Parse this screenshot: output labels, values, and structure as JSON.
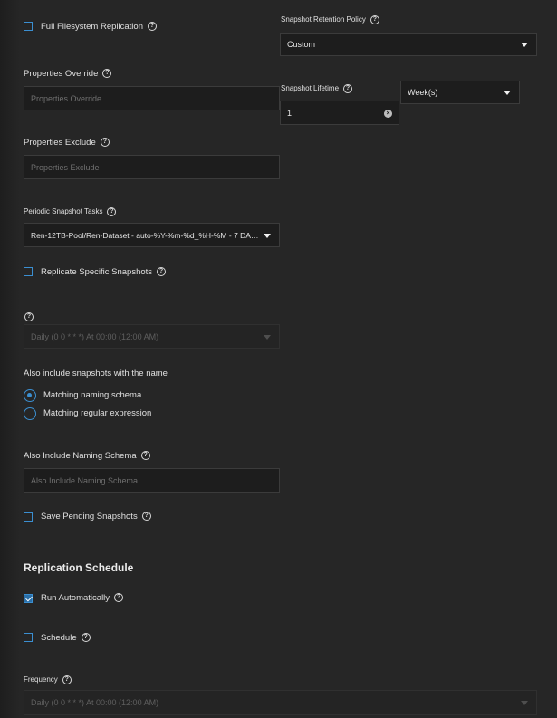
{
  "full_fs": {
    "label": "Full Filesystem Replication",
    "checked": false
  },
  "retention": {
    "label": "Snapshot Retention Policy",
    "value": "Custom"
  },
  "lifetime": {
    "label": "Snapshot Lifetime",
    "value": "1",
    "unit": "Week(s)"
  },
  "props_override": {
    "label": "Properties Override",
    "placeholder": "Properties Override"
  },
  "props_exclude": {
    "label": "Properties Exclude",
    "placeholder": "Properties Exclude"
  },
  "periodic": {
    "label": "Periodic Snapshot Tasks",
    "value": "Ren-12TB-Pool/Ren-Dataset - auto-%Y-%m-%d_%H-%M - 7 DA…"
  },
  "replicate_specific": {
    "label": "Replicate Specific Snapshots",
    "checked": false
  },
  "specific_schedule": {
    "value": "Daily (0 0 * * *)  At 00:00 (12:00 AM)"
  },
  "also_include": {
    "label": "Also include snapshots with the name",
    "options": [
      "Matching naming schema",
      "Matching regular expression"
    ],
    "selected": 0
  },
  "naming_schema": {
    "label": "Also Include Naming Schema",
    "placeholder": "Also Include Naming Schema"
  },
  "save_pending": {
    "label": "Save Pending Snapshots",
    "checked": false
  },
  "schedule_section": {
    "title": "Replication Schedule",
    "run_auto": {
      "label": "Run Automatically",
      "checked": true
    },
    "schedule": {
      "label": "Schedule",
      "checked": false
    },
    "frequency": {
      "label": "Frequency",
      "value": "Daily (0 0 * * *)  At 00:00 (12:00 AM)"
    }
  },
  "colors": {
    "background": "#262626",
    "field": "#1d1d1d",
    "accent": "#3b8fd1"
  },
  "icons": {
    "help": "question-circle-icon",
    "caret": "caret-down-icon",
    "clear": "clear-circle-icon"
  }
}
